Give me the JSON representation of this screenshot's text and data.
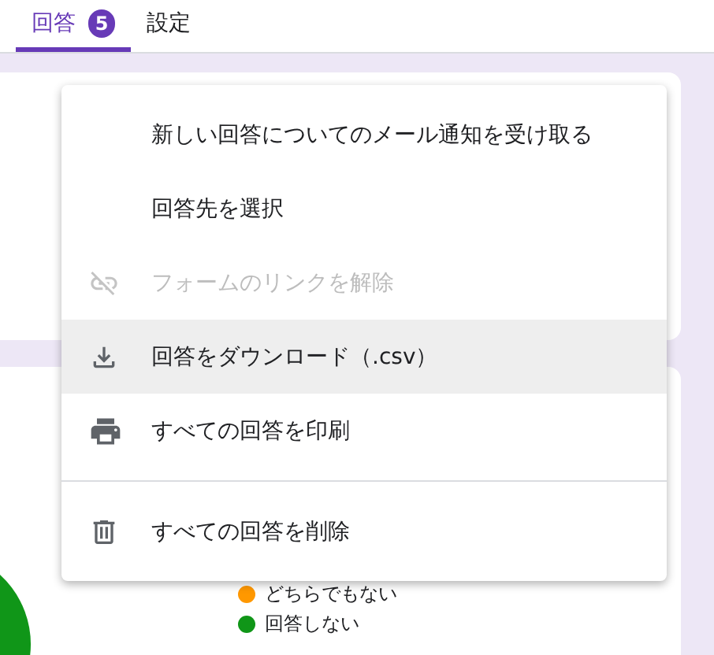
{
  "tabs": [
    {
      "label": "回答",
      "badge": "5",
      "selected": true
    },
    {
      "label": "設定",
      "selected": false
    }
  ],
  "legend": [
    {
      "label": "どちらでもない",
      "color": "#ff9800"
    },
    {
      "label": "回答しない",
      "color": "#109618"
    }
  ],
  "menu": [
    {
      "kind": "plain",
      "label": "新しい回答についてのメール通知を受け取る",
      "disabled": false,
      "highlighted": false,
      "divider_before": false
    },
    {
      "kind": "plain",
      "label": "回答先を選択",
      "disabled": false,
      "highlighted": false,
      "divider_before": false
    },
    {
      "kind": "unlink",
      "label": "フォームのリンクを解除",
      "disabled": true,
      "highlighted": false,
      "divider_before": false
    },
    {
      "kind": "download",
      "label": "回答をダウンロード（.csv）",
      "disabled": false,
      "highlighted": true,
      "divider_before": false
    },
    {
      "kind": "print",
      "label": "すべての回答を印刷",
      "disabled": false,
      "highlighted": false,
      "divider_before": false
    },
    {
      "kind": "delete",
      "label": "すべての回答を削除",
      "disabled": false,
      "highlighted": false,
      "divider_before": true
    }
  ]
}
